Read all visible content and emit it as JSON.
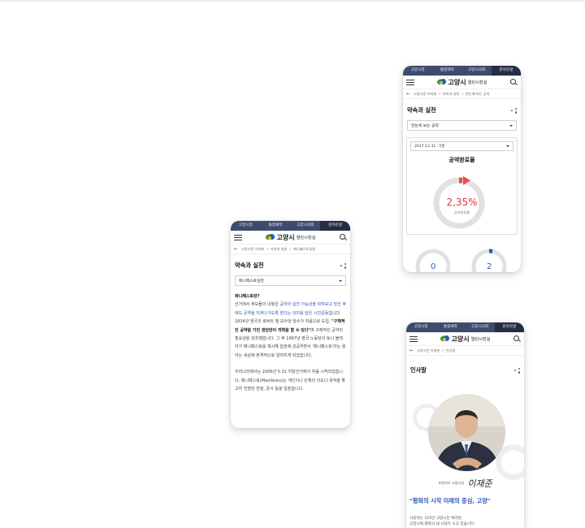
{
  "top_nav": [
    "고양시청",
    "통합예약",
    "고양시의회",
    "분야관광"
  ],
  "logo": {
    "city": "고양시",
    "sub": "열린시장실"
  },
  "colors": {
    "nav": "#3e4b6e",
    "accent": "#2a57b8",
    "red": "#e0383b",
    "progress": "#eb4d4f"
  },
  "phone_a": {
    "breadcrumb": [
      "고양시민 이자춘",
      "약속과 실천",
      "매니페스토실천"
    ],
    "title": "약속과 실천",
    "select": "매니페스토실천",
    "heading": "매니페스토란?",
    "para1": [
      {
        "t": "선거에서 후보들이 내놓은 ",
        "c": "n"
      },
      {
        "t": "공약의 실천 가능성을 따져보고 당선 후에도 공약을 지켜나가도록 한다는 의미를 담은 시민운동",
        "c": "h"
      },
      {
        "t": "입니다. 1834년 영국의 로버트 필 보수당 당수가 처음으로 도입, ",
        "c": "n"
      },
      {
        "t": "\"구체적인 공약을 가진 정당만이 개혁을 할 수 있다\"",
        "c": "b"
      },
      {
        "t": "며 구체적인 공약의 필요성을 강조했습니다. 그 후 1997년 영국 노동당의 토니 블레어가 매니페스토를 제시해 집권에 성공하면서 '매니페스토'라는 용어는 세상에 본격적으로 알려지게 되었습니다.",
        "c": "n"
      }
    ],
    "para2": "우리나라에서는 2006년 5.31 지방선거에서 처음 시작되었습니다. 매니페스토(Manifesto)는 개인이나 단체의 의도나 목적을 확고히 천명한 연설, 문서 등을 일컫습니다."
  },
  "phone_b": {
    "breadcrumb": [
      "고양시민 이자춘",
      "약속과 실천",
      "한눈에 보는 공약"
    ],
    "title": "약속과 실천",
    "select": "한눈에 보는 공약",
    "date_select": "2017.12.31. 기준",
    "panel_label": "공약완료율",
    "percent_text": "2,35%",
    "gauge_caption": "공약완료율",
    "progress_fraction": 0.0235,
    "mini": [
      "0",
      "2"
    ]
  },
  "phone_c": {
    "breadcrumb": [
      "고양시민 이자춘",
      "인사말"
    ],
    "title": "인사말",
    "sig_caption": "호연지기 고양시장",
    "sig_name": "이재준",
    "slogan": "\"평화의 시작 미래의 중심, 고양\"",
    "greeting": [
      "사랑하는 105만 고양시민 여러분,",
      "고양시에 평화의 새 시대가 오고 있습니다."
    ]
  }
}
